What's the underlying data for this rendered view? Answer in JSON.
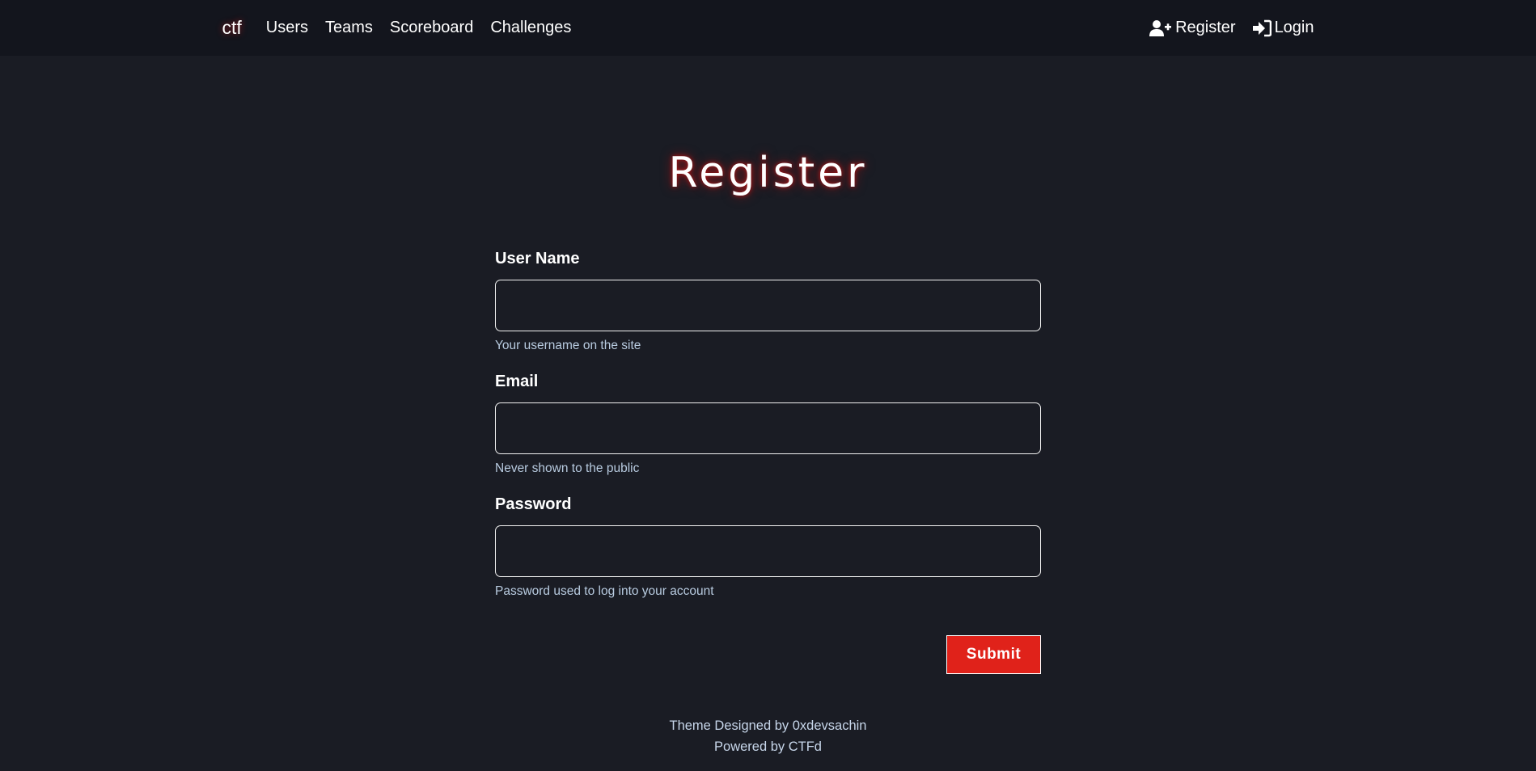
{
  "nav": {
    "brand": "ctf",
    "links": [
      "Users",
      "Teams",
      "Scoreboard",
      "Challenges"
    ],
    "register": {
      "label": "Register",
      "icon": "user-plus-icon"
    },
    "login": {
      "label": "Login",
      "icon": "sign-in-icon"
    }
  },
  "page": {
    "title": "Register"
  },
  "form": {
    "fields": [
      {
        "label": "User Name",
        "value": "",
        "placeholder": "",
        "help": "Your username on the site",
        "type": "text"
      },
      {
        "label": "Email",
        "value": "",
        "placeholder": "",
        "help": "Never shown to the public",
        "type": "email"
      },
      {
        "label": "Password",
        "value": "",
        "placeholder": "",
        "help": "Password used to log into your account",
        "type": "password"
      }
    ],
    "submit_label": "Submit"
  },
  "footer": {
    "line1": "Theme Designed by 0xdevsachin",
    "line2": "Powered by CTFd"
  },
  "colors": {
    "background": "#1a1c24",
    "navbar": "#13151d",
    "accent": "#e0221a",
    "help_text": "#b8cbe0"
  }
}
